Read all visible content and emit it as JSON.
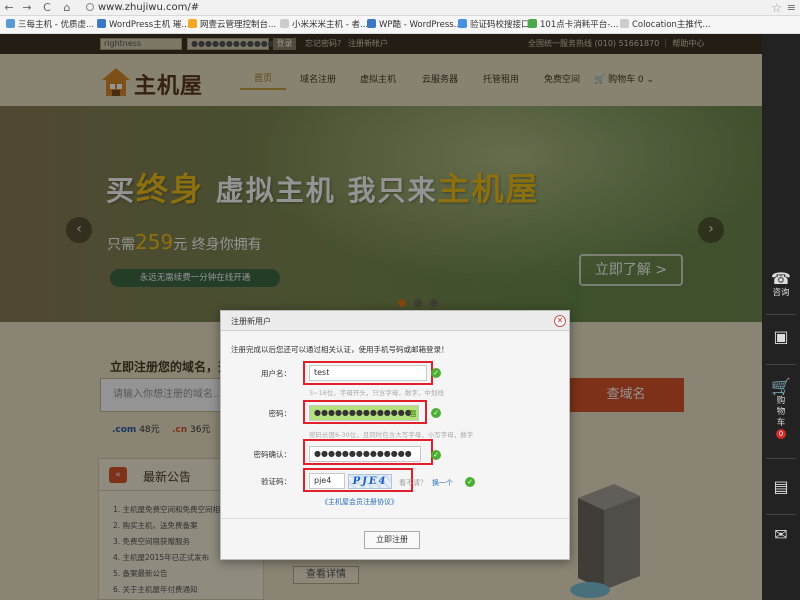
{
  "browser": {
    "url": "www.zhujiwu.com/#",
    "back": "←",
    "forward": "→",
    "reload": "C",
    "home": "⌂",
    "star": "☆",
    "menu": "≡",
    "bookmarks": [
      {
        "label": "三每主机 - 优质虚...",
        "color": "#5a9bd5"
      },
      {
        "label": "WordPress主机 璀...",
        "color": "#3a78c3"
      },
      {
        "label": "网壹云管理控制台...",
        "color": "#f5a623"
      },
      {
        "label": "小米米米主机 - 者...",
        "color": "#cccccc"
      },
      {
        "label": "WP酷 - WordPress...",
        "color": "#3a78c3"
      },
      {
        "label": "验证码校搜接口",
        "color": "#4a90e2"
      },
      {
        "label": "101点卡消耗平台-...",
        "color": "#4aa84a"
      },
      {
        "label": "Colocation主推代...",
        "color": "#cccccc"
      }
    ]
  },
  "topbar": {
    "username_value": "rightness",
    "password_value": "●●●●●●●●●●●●",
    "login_label": "登录",
    "forgot_label": "忘记密码？",
    "register_label": "注册新帐户",
    "hotline": "全国统一服务热线 (010) 51661870 ｜ 帮助中心"
  },
  "header": {
    "logo_text": "主机屋",
    "nav": [
      "首页",
      "域名注册",
      "虚拟主机",
      "云服务器",
      "托管租用",
      "免费空间",
      "🛒 购物车 0 ⌄"
    ]
  },
  "banner": {
    "headline_pre": "买",
    "headline_hl": "终身",
    "headline_mid": "虚拟主机 我只来",
    "headline_hl2": "主机屋",
    "sub_pre": "只需",
    "sub_price": "259",
    "sub_post": "元 终身你拥有",
    "pill": "永远无需续费一分钟在线开通",
    "cta": "立即了解 >",
    "prev": "‹",
    "next": "›"
  },
  "domain": {
    "title": "立即注册您的域名，开...",
    "placeholder": "请输入你想注册的域名...",
    "search_label": "查域名",
    "com_name": ".com",
    "com_price": "48元",
    "cn_name": ".cn",
    "cn_price": "36元"
  },
  "news": {
    "title": "最新公告",
    "icon": "«",
    "items": [
      "1. 主机屋免费空间和免费空间相...",
      "2. 购买主机，送免费备案",
      "3. 免费空间限获赠服务",
      "4. 主机屋2015年已正式发布",
      "5. 备案最新公告",
      "6. 关于主机屋年付费通知"
    ],
    "detail_label": "查看详情"
  },
  "sidebar": {
    "support_icon": "☎",
    "support_label": "咨询",
    "screen_icon": "▣",
    "cart_icon": "🛒",
    "cart_label_1": "购",
    "cart_label_2": "物",
    "cart_label_3": "车",
    "cart_count": "0",
    "doc_icon": "▤",
    "chat_icon": "✉"
  },
  "modal": {
    "title": "注册新用户",
    "close": "✕",
    "notice": "注册完成以后您还可以通过相关认证，使用手机号码或邮箱登录！",
    "username_label": "用户名：",
    "username_value": "test",
    "username_hint": "3~16位，字母开头，只含字母，数字，中划线",
    "password_label": "密码：",
    "password_value": "●●●●●●●●●●●●●●",
    "password_strength": "强",
    "password_hint": "密码长度6-30位，且同时包含大写字母，小写字母，数字",
    "confirm_label": "密码确认：",
    "confirm_value": "●●●●●●●●●●●●●●",
    "captcha_label": "验证码：",
    "captcha_value": "pje4",
    "captcha_image_text": "PJE4",
    "captcha_question": "看不清？",
    "captcha_refresh": "换一个",
    "ok_mark": "✓",
    "agreement": "《主机屋会员注册协议》",
    "submit": "立即注册"
  }
}
